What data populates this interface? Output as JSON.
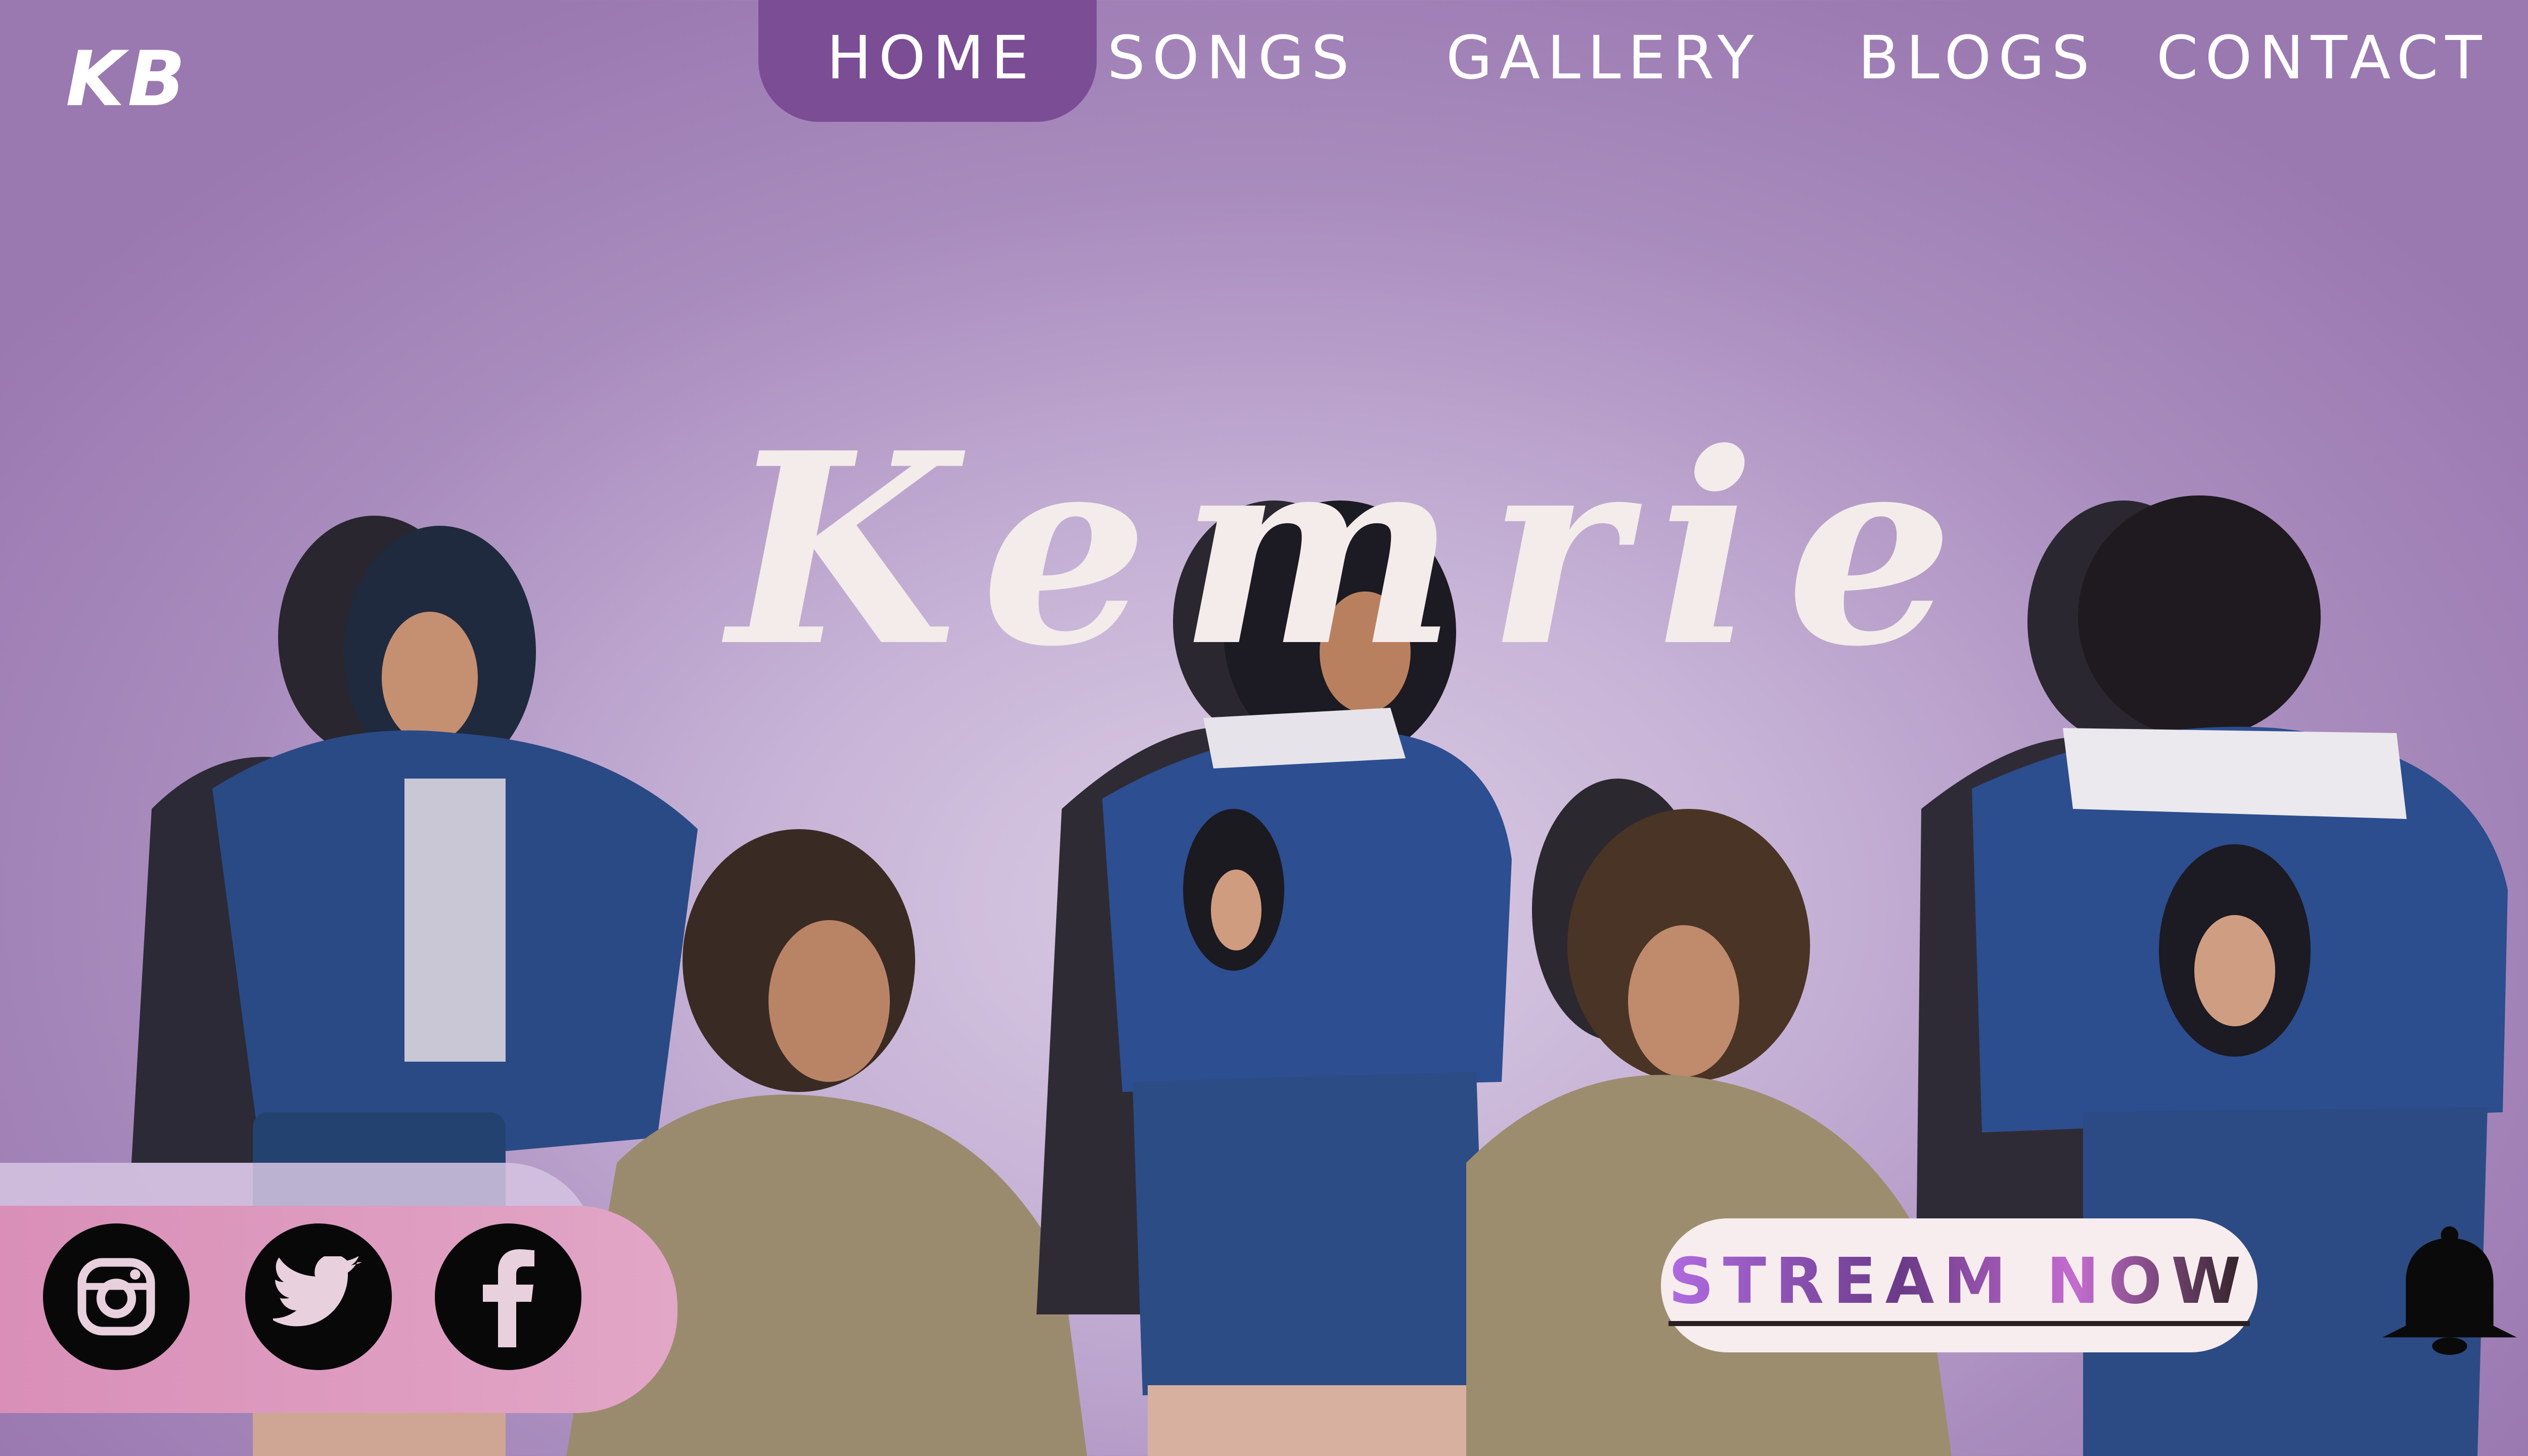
{
  "logo": "KB",
  "nav": [
    {
      "label": "HOME",
      "active": true
    },
    {
      "label": "SONGS",
      "active": false
    },
    {
      "label": "GALLERY",
      "active": false
    },
    {
      "label": "BLOGS",
      "active": false
    },
    {
      "label": "CONTACT",
      "active": false
    }
  ],
  "hero": {
    "title": "Kemrie"
  },
  "social": [
    {
      "icon": "instagram-icon"
    },
    {
      "icon": "twitter-icon"
    },
    {
      "icon": "facebook-icon"
    }
  ],
  "cta": {
    "label": "STREAM NOW"
  },
  "notification": {
    "icon": "bell-icon"
  },
  "colors": {
    "nav_active": "#7b4d95",
    "title": "#f4ecea",
    "social_bar": "#e2a6c6",
    "button_bg": "#f7ecee",
    "jacket": "#23407a",
    "shirt": "#9a8a6a"
  }
}
